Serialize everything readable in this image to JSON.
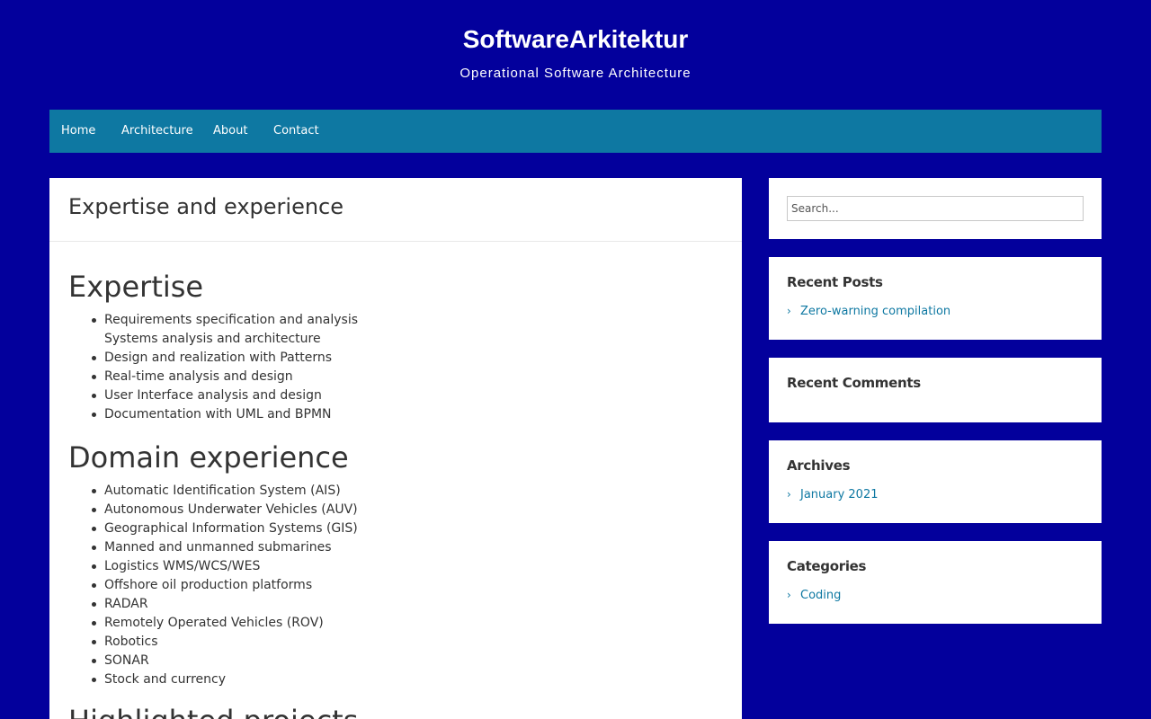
{
  "site": {
    "title": "SoftwareArkitektur",
    "tagline": "Operational Software Architecture"
  },
  "nav": {
    "items": [
      "Home",
      "Architecture",
      "About",
      "Contact"
    ]
  },
  "post": {
    "title": "Expertise and experience",
    "sections": [
      {
        "heading": "Expertise",
        "items": [
          "Requirements specification and analysis",
          "Systems analysis and architecture",
          "Design and realization with Patterns",
          "Real-time analysis and design",
          "User Interface analysis and design",
          "Documentation with UML and BPMN"
        ]
      },
      {
        "heading": "Domain experience",
        "items": [
          "Automatic Identification System (AIS)",
          "Autonomous Underwater Vehicles (AUV)",
          "Geographical Information Systems (GIS)",
          "Manned and unmanned submarines",
          "Logistics WMS/WCS/WES",
          "Offshore oil production platforms",
          "RADAR",
          "Remotely Operated Vehicles (ROV)",
          "Robotics",
          "SONAR",
          "Stock and currency"
        ]
      },
      {
        "heading": "Highlighted projects"
      }
    ]
  },
  "sidebar": {
    "search": {
      "placeholder": "Search..."
    },
    "recent_posts": {
      "title": "Recent Posts",
      "items": [
        "Zero-warning compilation"
      ]
    },
    "recent_comments": {
      "title": "Recent Comments"
    },
    "archives": {
      "title": "Archives",
      "items": [
        "January 2021"
      ]
    },
    "categories": {
      "title": "Categories",
      "items": [
        "Coding"
      ]
    }
  },
  "colors": {
    "background": "#03009c",
    "nav": "#0e78a2",
    "link": "#0e78a2",
    "text": "#333333"
  },
  "icons": {
    "list_bullet": "bullet-icon",
    "link_marker": "chevron-right-icon"
  }
}
